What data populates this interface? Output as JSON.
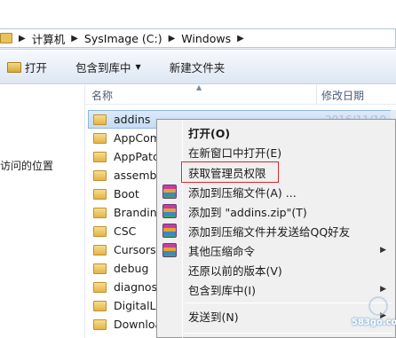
{
  "address": {
    "crumbs": [
      "计算机",
      "SysImage (C:)",
      "Windows"
    ]
  },
  "toolbar": {
    "open_label": "打开",
    "include_label": "包含到库中",
    "new_folder_label": "新建文件夹"
  },
  "navpane": {
    "recent_label": "访问的位置"
  },
  "columns": {
    "name": "名称",
    "date": "修改日期"
  },
  "files": [
    {
      "name": "addins",
      "date": "2016/11/19 0"
    },
    {
      "name": "AppComp",
      "date": ""
    },
    {
      "name": "AppPatch",
      "date": ""
    },
    {
      "name": "assembly",
      "date": ""
    },
    {
      "name": "Boot",
      "date": ""
    },
    {
      "name": "Branding",
      "date": ""
    },
    {
      "name": "CSC",
      "date": ""
    },
    {
      "name": "Cursors",
      "date": ""
    },
    {
      "name": "debug",
      "date": ""
    },
    {
      "name": "diagnosti",
      "date": ""
    },
    {
      "name": "DigitalLoc",
      "date": ""
    },
    {
      "name": "Download",
      "date": ""
    }
  ],
  "context_menu": {
    "open": "打开(O)",
    "open_new_window": "在新窗口中打开(E)",
    "get_admin": "获取管理员权限",
    "add_to_archive": "添加到压缩文件(A) ...",
    "add_to_addins_zip": "添加到 \"addins.zip\"(T)",
    "add_and_send_qq": "添加到压缩文件并发送给QQ好友",
    "other_compress": "其他压缩命令",
    "restore_previous": "还原以前的版本(V)",
    "include_in_library": "包含到库中(I)",
    "send_to": "发送到(N)"
  },
  "watermark": {
    "text": "583go.com"
  },
  "colors": {
    "highlight_border": "#e0262b",
    "selection": "#c6dcf5"
  }
}
